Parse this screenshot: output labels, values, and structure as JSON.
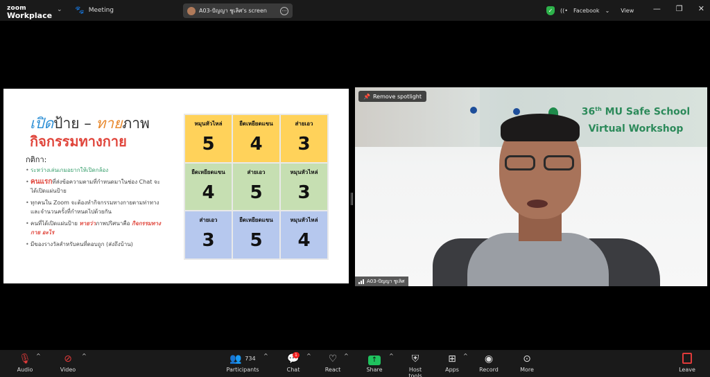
{
  "app": {
    "brand_top": "zoom",
    "brand_bottom": "Workplace",
    "meeting_label": "Meeting",
    "shared_screen_label": "A03-ปัญญา ชูเลิศ's screen",
    "facebook_label": "Facebook",
    "view_label": "View",
    "window_controls": [
      "minimize",
      "maximize",
      "close"
    ]
  },
  "slide": {
    "title_part1": "เปิด",
    "title_part2": "ป้าย",
    "title_dash": " – ",
    "title_part3": "ทาย",
    "title_part4": "ภาพ",
    "subtitle": "กิจกรรมทางกาย",
    "rules_heading": "กติกา:",
    "rules": [
      "ระหว่างเล่นเกมอยากให้เปิดกล้อง",
      "ที่ส่งข้อความตามที่กำหนดมาในช่อง Chat จะได้เปิดแผ่นป้าย",
      "ทุกคนใน Zoom จะต้องทำกิจกรรมทางกายตามท่าทางและจำนวนครั้งที่กำหนดไปด้วยกัน",
      "คนที่ได้เปิดแผ่นป้าย",
      "มีของรางวัลสำหรับคนที่ตอบถูก (ส่งถึงบ้าน)"
    ],
    "rule2_highlight": "คนแรก",
    "rule4_highlight1": "ทายว่า",
    "rule4_mid": "ภาพปริศนาคือ",
    "rule4_highlight2": "กิจกรรมทางกาย อะไร",
    "grid": [
      {
        "label": "หมุนหัวไหล่",
        "number": "5"
      },
      {
        "label": "ยืดเหยียดแขน",
        "number": "4"
      },
      {
        "label": "ส่ายเอว",
        "number": "3"
      },
      {
        "label": "ยืดเหยียดแขน",
        "number": "4"
      },
      {
        "label": "ส่ายเอว",
        "number": "5"
      },
      {
        "label": "หมุนหัวไหล่",
        "number": "3"
      },
      {
        "label": "ส่ายเอว",
        "number": "3"
      },
      {
        "label": "ยืดเหยียดแขน",
        "number": "5"
      },
      {
        "label": "หมุนหัวไหล่",
        "number": "4"
      }
    ]
  },
  "video": {
    "spotlight_button": "Remove spotlight",
    "banner_title_num": "36",
    "banner_title_sup": "th",
    "banner_title_rest": " MU Safe School",
    "banner_title_line2": "Virtual Workshop",
    "name_tag": "A03-ปัญญา ชูเลิศ"
  },
  "toolbar": {
    "audio": "Audio",
    "video": "Video",
    "participants": "Participants",
    "participants_count": "734",
    "chat": "Chat",
    "chat_badge": "1",
    "react": "React",
    "share": "Share",
    "host_tools": "Host tools",
    "apps": "Apps",
    "record": "Record",
    "more": "More",
    "leave": "Leave"
  }
}
